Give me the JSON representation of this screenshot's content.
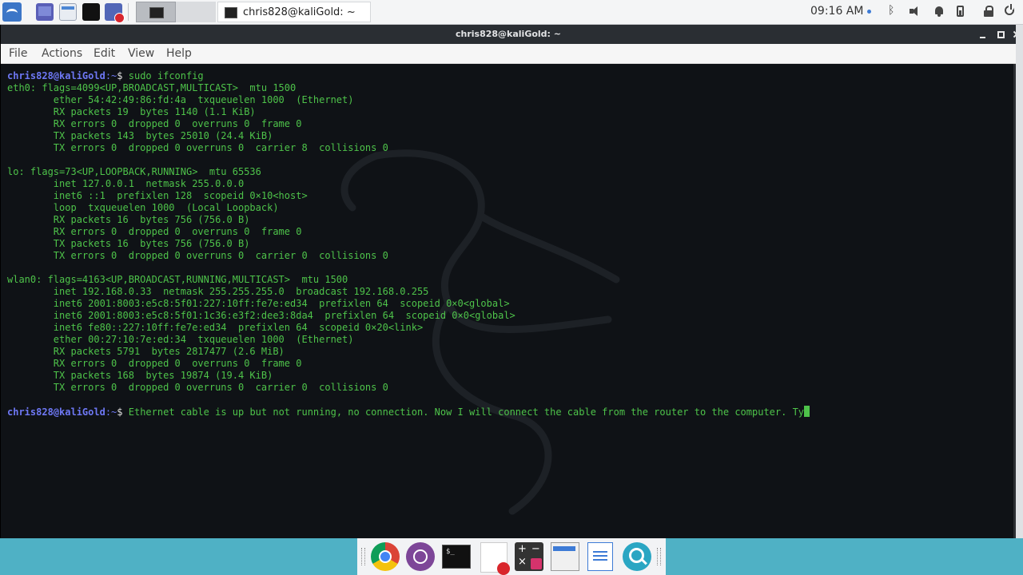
{
  "top_panel": {
    "window_title": "chris828@kaliGold: ~",
    "clock": "09:16 AM",
    "bluetooth_glyph": "ᛒ"
  },
  "window": {
    "title": "chris828@kaliGold: ~",
    "menu": {
      "file": "File",
      "actions": "Actions",
      "edit": "Edit",
      "view": "View",
      "help": "Help"
    }
  },
  "terminal": {
    "prompt_user": "chris828@kaliGold",
    "prompt_sep": ":~",
    "prompt_dollar": "$",
    "command": " sudo ifconfig",
    "output": "eth0: flags=4099<UP,BROADCAST,MULTICAST>  mtu 1500\n        ether 54:42:49:86:fd:4a  txqueuelen 1000  (Ethernet)\n        RX packets 19  bytes 1140 (1.1 KiB)\n        RX errors 0  dropped 0  overruns 0  frame 0\n        TX packets 143  bytes 25010 (24.4 KiB)\n        TX errors 0  dropped 0 overruns 0  carrier 8  collisions 0\n\nlo: flags=73<UP,LOOPBACK,RUNNING>  mtu 65536\n        inet 127.0.0.1  netmask 255.0.0.0\n        inet6 ::1  prefixlen 128  scopeid 0×10<host>\n        loop  txqueuelen 1000  (Local Loopback)\n        RX packets 16  bytes 756 (756.0 B)\n        RX errors 0  dropped 0  overruns 0  frame 0\n        TX packets 16  bytes 756 (756.0 B)\n        TX errors 0  dropped 0 overruns 0  carrier 0  collisions 0\n\nwlan0: flags=4163<UP,BROADCAST,RUNNING,MULTICAST>  mtu 1500\n        inet 192.168.0.33  netmask 255.255.255.0  broadcast 192.168.0.255\n        inet6 2001:8003:e5c8:5f01:227:10ff:fe7e:ed34  prefixlen 64  scopeid 0×0<global>\n        inet6 2001:8003:e5c8:5f01:1c36:e3f2:dee3:8da4  prefixlen 64  scopeid 0×0<global>\n        inet6 fe80::227:10ff:fe7e:ed34  prefixlen 64  scopeid 0×20<link>\n        ether 00:27:10:7e:ed:34  txqueuelen 1000  (Ethernet)\n        RX packets 5791  bytes 2817477 (2.6 MiB)\n        RX errors 0  dropped 0  overruns 0  frame 0\n        TX packets 168  bytes 19874 (19.4 KiB)\n        TX errors 0  dropped 0 overruns 0  carrier 0  collisions 0\n\n",
    "current_input": " Ethernet cable is up but not running, no connection. Now I will connect the cable from the router to the computer. Ty"
  },
  "dock": {
    "terminal_label": "$_",
    "calc_glyph": "+−\n×="
  },
  "colors": {
    "terminal_bg": "#0f1216",
    "terminal_text": "#4ec34a",
    "prompt": "#6e78f5",
    "dock_bar": "#4fb1c5"
  }
}
